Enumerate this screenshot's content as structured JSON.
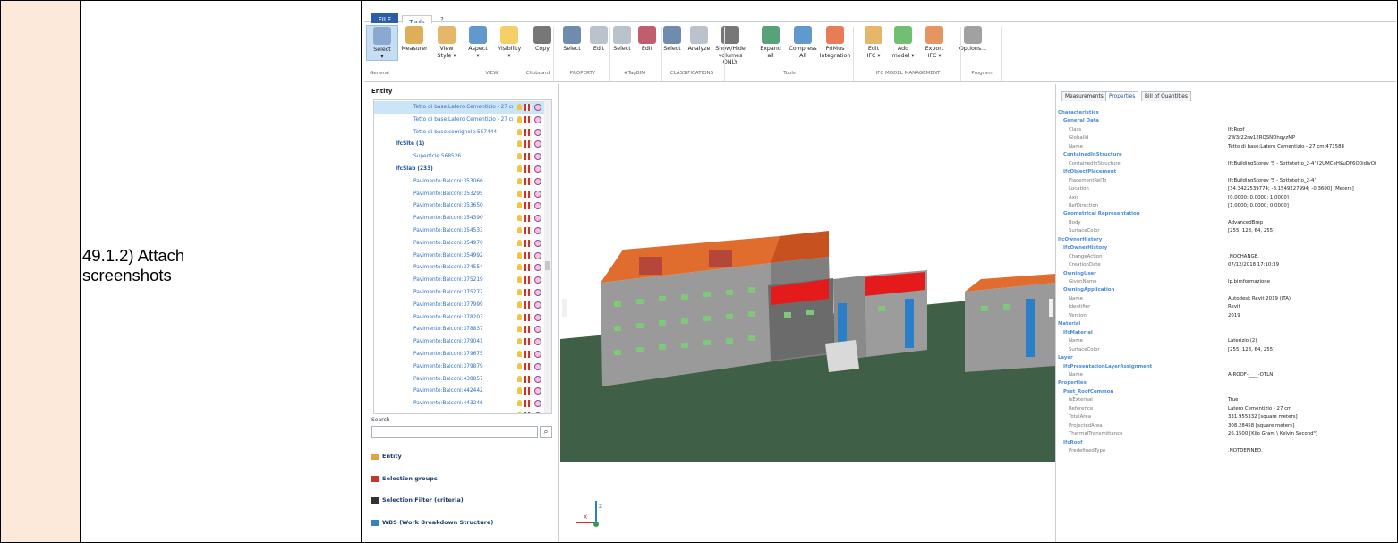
{
  "doc": {
    "step_label": "49.1.2) Attach\nscreenshots"
  },
  "app": {
    "menu": {
      "file": "FILE",
      "tools": "Tools",
      "help": "?"
    },
    "ribbon": {
      "buttons": [
        {
          "name": "select",
          "label": "Select",
          "sub": "▾",
          "icon": "cursor-icon",
          "color": "#7a9cc8"
        },
        {
          "name": "measurer",
          "label": "Measurer",
          "sub": "",
          "icon": "pencil-icon",
          "color": "#d49b2e"
        },
        {
          "name": "view-style",
          "label": "View",
          "sub": "Style ▾",
          "icon": "cube-icon",
          "color": "#e0a446"
        },
        {
          "name": "aspect",
          "label": "Aspect",
          "sub": "▾",
          "icon": "house-icon",
          "color": "#3a7fbf"
        },
        {
          "name": "visibility",
          "label": "Visibility",
          "sub": "▾",
          "icon": "bulb-icon",
          "color": "#f2c443"
        },
        {
          "name": "copy",
          "label": "Copy",
          "sub": "",
          "icon": "copy-icon",
          "color": "#555555"
        },
        {
          "name": "property-select",
          "label": "Select",
          "sub": "",
          "icon": "property-select-icon",
          "color": "#4b6e9a"
        },
        {
          "name": "property-edit",
          "label": "Edit",
          "sub": "",
          "icon": "property-edit-icon",
          "color": "#a9b3bf"
        },
        {
          "name": "tagbim-select",
          "label": "Select",
          "sub": "",
          "icon": "hash-icon",
          "color": "#a9b3bf"
        },
        {
          "name": "tagbim-edit",
          "label": "Edit",
          "sub": "",
          "icon": "hash-edit-icon",
          "color": "#b0344a"
        },
        {
          "name": "class-select",
          "label": "Select",
          "sub": "",
          "icon": "classification-select-icon",
          "color": "#4b6e9a"
        },
        {
          "name": "class-analyze",
          "label": "Analyze",
          "sub": "",
          "icon": "classification-analyze-icon",
          "color": "#a9b3bf"
        },
        {
          "name": "show-hide",
          "label": "Show/Hide",
          "sub": "volumes ONLY",
          "icon": "box-outline-icon",
          "color": "#555555"
        },
        {
          "name": "expand-all",
          "label": "Expand",
          "sub": "all",
          "icon": "expand-tree-icon",
          "color": "#2e8b57"
        },
        {
          "name": "compress-all",
          "label": "Compress",
          "sub": "All",
          "icon": "compress-tree-icon",
          "color": "#3a7fbf"
        },
        {
          "name": "primus",
          "label": "PriMus",
          "sub": "Integration",
          "icon": "puzzle-icon",
          "color": "#e25b2b"
        },
        {
          "name": "edit-ifc",
          "label": "Edit",
          "sub": "IFC ▾",
          "icon": "edit-ifc-icon",
          "color": "#e0a446"
        },
        {
          "name": "add-model",
          "label": "Add",
          "sub": "model ▾",
          "icon": "add-model-icon",
          "color": "#4caf50"
        },
        {
          "name": "export-ifc",
          "label": "Export",
          "sub": "IFC ▾",
          "icon": "export-ifc-icon",
          "color": "#e07b39"
        },
        {
          "name": "options",
          "label": "Options...",
          "sub": "",
          "icon": "gears-icon",
          "color": "#8a8a8a"
        }
      ],
      "groups": [
        "General",
        "VIEW",
        "Clipboard",
        "PROPERTY",
        "#TagBIM",
        "CLASSIFICATIONS",
        "Tools",
        "IFC MODEL MANAGEMENT",
        "Program"
      ]
    },
    "left": {
      "entity_header": "Entity",
      "tree": [
        {
          "label": "Tetto di base:Latero Cementizio - 27 cı",
          "indent": 1,
          "hl": true,
          "hdr": false
        },
        {
          "label": "Tetto di base:Latero Cementizio - 27 cı",
          "indent": 1,
          "hl": false,
          "hdr": false
        },
        {
          "label": "Tetto di base:comignolo:557444",
          "indent": 1,
          "hl": false,
          "hdr": false
        },
        {
          "label": "IfcSite (1)",
          "indent": 0,
          "hl": false,
          "hdr": true
        },
        {
          "label": "Superficie:568526",
          "indent": 1,
          "hl": false,
          "hdr": false
        },
        {
          "label": "IfcSlab (233)",
          "indent": 0,
          "hl": false,
          "hdr": true
        },
        {
          "label": "Pavimento:Balconi:353066",
          "indent": 1,
          "hl": false,
          "hdr": false
        },
        {
          "label": "Pavimento:Balconi:353295",
          "indent": 1,
          "hl": false,
          "hdr": false
        },
        {
          "label": "Pavimento:Balconi:353650",
          "indent": 1,
          "hl": false,
          "hdr": false
        },
        {
          "label": "Pavimento:Balconi:354390",
          "indent": 1,
          "hl": false,
          "hdr": false
        },
        {
          "label": "Pavimento:Balconi:354533",
          "indent": 1,
          "hl": false,
          "hdr": false
        },
        {
          "label": "Pavimento:Balconi:354970",
          "indent": 1,
          "hl": false,
          "hdr": false
        },
        {
          "label": "Pavimento:Balconi:354992",
          "indent": 1,
          "hl": false,
          "hdr": false
        },
        {
          "label": "Pavimento:Balconi:374554",
          "indent": 1,
          "hl": false,
          "hdr": false
        },
        {
          "label": "Pavimento:Balconi:375219",
          "indent": 1,
          "hl": false,
          "hdr": false
        },
        {
          "label": "Pavimento:Balconi:375272",
          "indent": 1,
          "hl": false,
          "hdr": false
        },
        {
          "label": "Pavimento:Balconi:377999",
          "indent": 1,
          "hl": false,
          "hdr": false
        },
        {
          "label": "Pavimento:Balconi:378203",
          "indent": 1,
          "hl": false,
          "hdr": false
        },
        {
          "label": "Pavimento:Balconi:378837",
          "indent": 1,
          "hl": false,
          "hdr": false
        },
        {
          "label": "Pavimento:Balconi:379041",
          "indent": 1,
          "hl": false,
          "hdr": false
        },
        {
          "label": "Pavimento:Balconi:379675",
          "indent": 1,
          "hl": false,
          "hdr": false
        },
        {
          "label": "Pavimento:Balconi:379879",
          "indent": 1,
          "hl": false,
          "hdr": false
        },
        {
          "label": "Pavimento:Balconi:438857",
          "indent": 1,
          "hl": false,
          "hdr": false
        },
        {
          "label": "Pavimento:Balconi:442442",
          "indent": 1,
          "hl": false,
          "hdr": false
        },
        {
          "label": "Pavimento:Balconi:443246",
          "indent": 1,
          "hl": false,
          "hdr": false
        },
        {
          "label": "Pavimento:Balconi:462445",
          "indent": 1,
          "hl": false,
          "hdr": false
        }
      ],
      "search_label": "Search",
      "nav": [
        {
          "name": "entity",
          "label": "Entity",
          "icon": "entity-icon",
          "color": "#e0a446"
        },
        {
          "name": "selection-groups",
          "label": "Selection groups",
          "icon": "selection-groups-icon",
          "color": "#c0392b"
        },
        {
          "name": "selection-filter",
          "label": "Selection Filter (criteria)",
          "icon": "filter-icon",
          "color": "#333333"
        },
        {
          "name": "wbs",
          "label": "WBS (Work Breakdown Structure)",
          "icon": "wbs-icon",
          "color": "#3a7fbf"
        }
      ]
    },
    "viewport": {
      "axis_x": "X",
      "axis_z": "Z"
    },
    "right": {
      "tabs": [
        "Measurements",
        "Properties",
        "Bill of Quantities"
      ],
      "active_tab": "Properties",
      "props": [
        {
          "t": "sec",
          "lvl": 0,
          "k": "Characteristics",
          "v": ""
        },
        {
          "t": "sec",
          "lvl": 1,
          "k": "General Data",
          "v": ""
        },
        {
          "t": "key",
          "lvl": 2,
          "k": "Class",
          "v": "IfcRoof"
        },
        {
          "t": "key",
          "lvl": 2,
          "k": "GlobalId",
          "v": "2W3r22rw12RQSNDhqyzMP_"
        },
        {
          "t": "key",
          "lvl": 2,
          "k": "Name",
          "v": "Tetto di base:Latero Cementizio - 27 cm:471588"
        },
        {
          "t": "sec",
          "lvl": 1,
          "k": "ContainedInStructure",
          "v": ""
        },
        {
          "t": "key",
          "lvl": 2,
          "k": "ContainedInStructure",
          "v": "IfcBuildingStorey '5 - Sottotetto_2-4' (2UMCeH$uDF6Q0jdjvOj"
        },
        {
          "t": "sec",
          "lvl": 1,
          "k": "IfcObjectPlacement",
          "v": ""
        },
        {
          "t": "key",
          "lvl": 2,
          "k": "PlacementRelTo",
          "v": "IfcBuildingStorey '5 - Sottotetto_2-4'"
        },
        {
          "t": "key",
          "lvl": 2,
          "k": "Location",
          "v": "[34.3422539774; -8.1549227994; -0.3600] [Meters]"
        },
        {
          "t": "key",
          "lvl": 2,
          "k": "Axis",
          "v": "[0.0000; 0.0000; 1.0000]"
        },
        {
          "t": "key",
          "lvl": 2,
          "k": "RefDirection",
          "v": "[1.0000; 0.0000; 0.0000]"
        },
        {
          "t": "sec",
          "lvl": 1,
          "k": "Geometrical Representation",
          "v": ""
        },
        {
          "t": "key",
          "lvl": 2,
          "k": "Body",
          "v": "AdvancedBrep"
        },
        {
          "t": "key",
          "lvl": 2,
          "k": "SurfaceColor",
          "v": "[255, 128, 64, 255]"
        },
        {
          "t": "sec",
          "lvl": 0,
          "k": "IfcOwnerHistory",
          "v": ""
        },
        {
          "t": "sec",
          "lvl": 1,
          "k": "IfcOwnerHistory",
          "v": ""
        },
        {
          "t": "key",
          "lvl": 2,
          "k": "ChangeAction",
          "v": ".NOCHANGE."
        },
        {
          "t": "key",
          "lvl": 2,
          "k": "CreationDate",
          "v": "07/12/2018 17:10:39"
        },
        {
          "t": "sec",
          "lvl": 1,
          "k": "OwningUser",
          "v": ""
        },
        {
          "t": "key",
          "lvl": 2,
          "k": "GivenName",
          "v": "lp.bimformazione"
        },
        {
          "t": "sec",
          "lvl": 1,
          "k": "OwningApplication",
          "v": ""
        },
        {
          "t": "key",
          "lvl": 2,
          "k": "Name",
          "v": "Autodesk Revit 2019 (ITA)"
        },
        {
          "t": "key",
          "lvl": 2,
          "k": "Identifier",
          "v": "Revit"
        },
        {
          "t": "key",
          "lvl": 2,
          "k": "Version",
          "v": "2019"
        },
        {
          "t": "sec",
          "lvl": 0,
          "k": "Material",
          "v": ""
        },
        {
          "t": "sec",
          "lvl": 1,
          "k": "IfcMaterial",
          "v": ""
        },
        {
          "t": "key",
          "lvl": 2,
          "k": "Name",
          "v": "Laterizio (2)"
        },
        {
          "t": "key",
          "lvl": 2,
          "k": "SurfaceColor",
          "v": "[255, 128, 64, 255]"
        },
        {
          "t": "sec",
          "lvl": 0,
          "k": "Layer",
          "v": ""
        },
        {
          "t": "sec",
          "lvl": 1,
          "k": "IfcPresentationLayerAssignment",
          "v": ""
        },
        {
          "t": "key",
          "lvl": 2,
          "k": "Name",
          "v": "A-ROOF-____-OTLN"
        },
        {
          "t": "sec",
          "lvl": 0,
          "k": "Properties",
          "v": ""
        },
        {
          "t": "sec",
          "lvl": 1,
          "k": "Pset_RoofCommon",
          "v": ""
        },
        {
          "t": "key",
          "lvl": 2,
          "k": "IsExternal",
          "v": "True"
        },
        {
          "t": "key",
          "lvl": 2,
          "k": "Reference",
          "v": "Latero Cementizio - 27 cm"
        },
        {
          "t": "key",
          "lvl": 2,
          "k": "TotalArea",
          "v": "331.955332 [square meters]"
        },
        {
          "t": "key",
          "lvl": 2,
          "k": "ProjectedArea",
          "v": "308.28458 [square meters]"
        },
        {
          "t": "key",
          "lvl": 2,
          "k": "ThermalTransmittance",
          "v": "26.1500 [Kilo Gram \\ Kelvin Second³]"
        },
        {
          "t": "sec",
          "lvl": 1,
          "k": "IfcRoof",
          "v": ""
        },
        {
          "t": "key",
          "lvl": 2,
          "k": "PredefinedType",
          "v": ".NOTDEFINED."
        }
      ]
    }
  }
}
